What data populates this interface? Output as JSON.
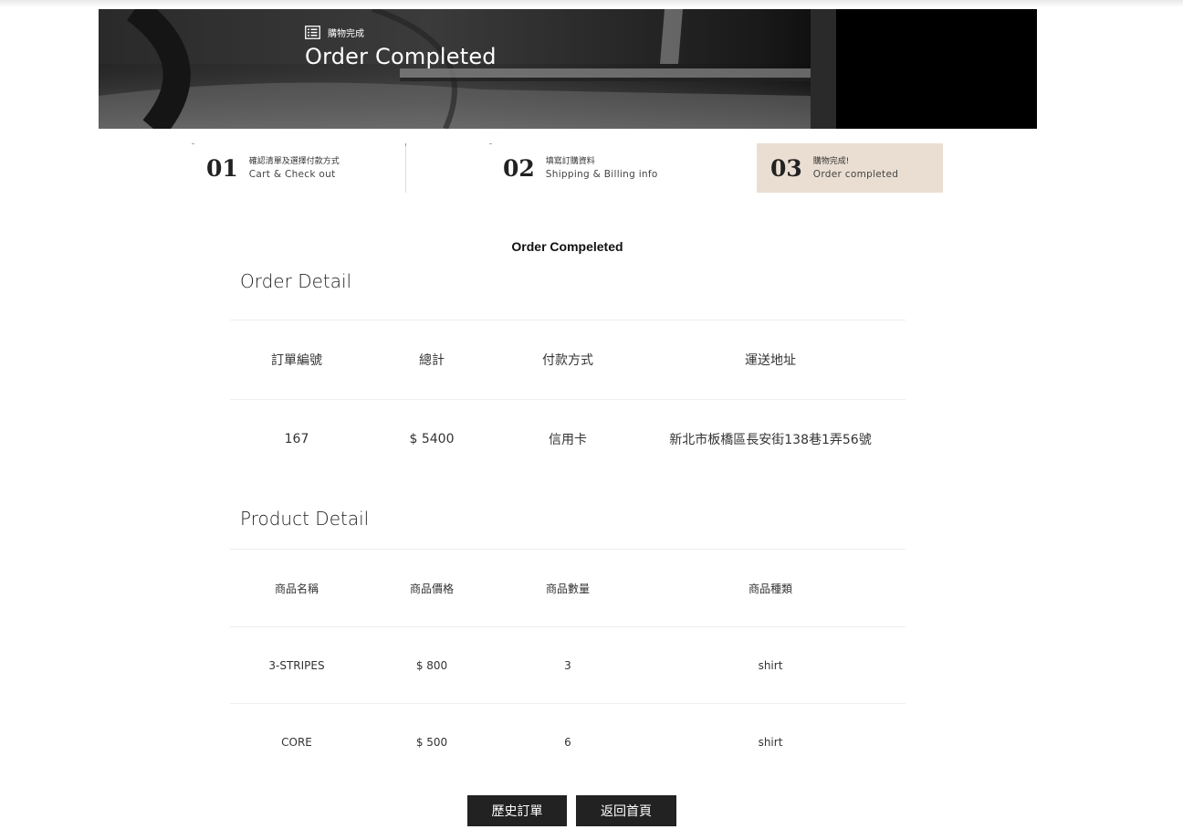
{
  "banner": {
    "crumb": "購物完成",
    "title": "Order Completed"
  },
  "steps": [
    {
      "num": "01",
      "zh": "確認清單及選擇付款方式",
      "en": "Cart & Check out"
    },
    {
      "num": "02",
      "zh": "填寫訂購資料",
      "en": "Shipping & Billing info"
    },
    {
      "num": "03",
      "zh": "購物完成!",
      "en": "Order completed"
    }
  ],
  "page_heading": "Order Compeleted",
  "order_detail": {
    "title": "Order Detail",
    "headers": [
      "訂單編號",
      "總計",
      "付款方式",
      "運送地址"
    ],
    "row": [
      "167",
      "$ 5400",
      "信用卡",
      "新北市板橋區長安街138巷1弄56號"
    ]
  },
  "product_detail": {
    "title": "Product Detail",
    "headers": [
      "商品名稱",
      "商品價格",
      "商品數量",
      "商品種類"
    ],
    "rows": [
      [
        "3-STRIPES",
        "$ 800",
        "3",
        "shirt"
      ],
      [
        "CORE",
        "$ 500",
        "6",
        "shirt"
      ]
    ]
  },
  "buttons": {
    "history": "歷史訂單",
    "home": "返回首頁"
  },
  "colors": {
    "active_step_bg": "#eaded2",
    "button_bg": "#222222"
  }
}
